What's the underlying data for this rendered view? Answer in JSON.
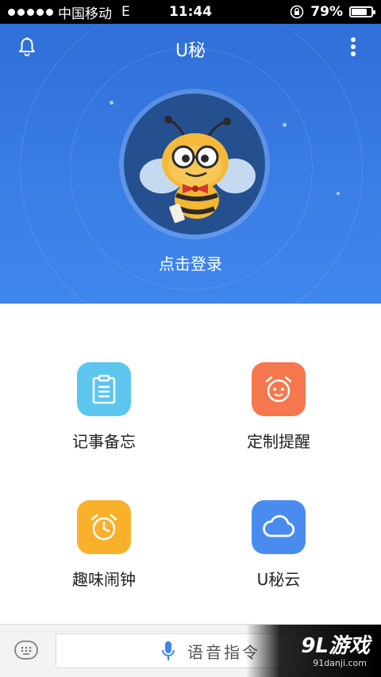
{
  "status_bar": {
    "carrier": "中国移动",
    "network": "E",
    "time": "11:44",
    "battery_percent": "79%",
    "battery_level": 0.79
  },
  "header": {
    "title": "U秘",
    "left_icon": "bell-icon",
    "right_icon": "more-vertical-icon",
    "login_label": "点击登录",
    "gradient_colors": [
      "#2f6fd7",
      "#3f86ec"
    ]
  },
  "features": [
    {
      "label": "记事备忘",
      "icon": "clipboard-icon",
      "color": "#5cc6ee"
    },
    {
      "label": "定制提醒",
      "icon": "alarm-face-icon",
      "color": "#f5774e"
    },
    {
      "label": "趣味闹钟",
      "icon": "alarm-clock-icon",
      "color": "#f9b12b"
    },
    {
      "label": "U秘云",
      "icon": "cloud-icon",
      "color": "#4a8bf0"
    }
  ],
  "bottom_bar": {
    "keyboard_icon": "keyboard-icon",
    "mic_icon": "microphone-icon",
    "voice_label": "语音指令"
  },
  "watermark": {
    "brand": "9L游戏",
    "site": "91danji.com"
  }
}
